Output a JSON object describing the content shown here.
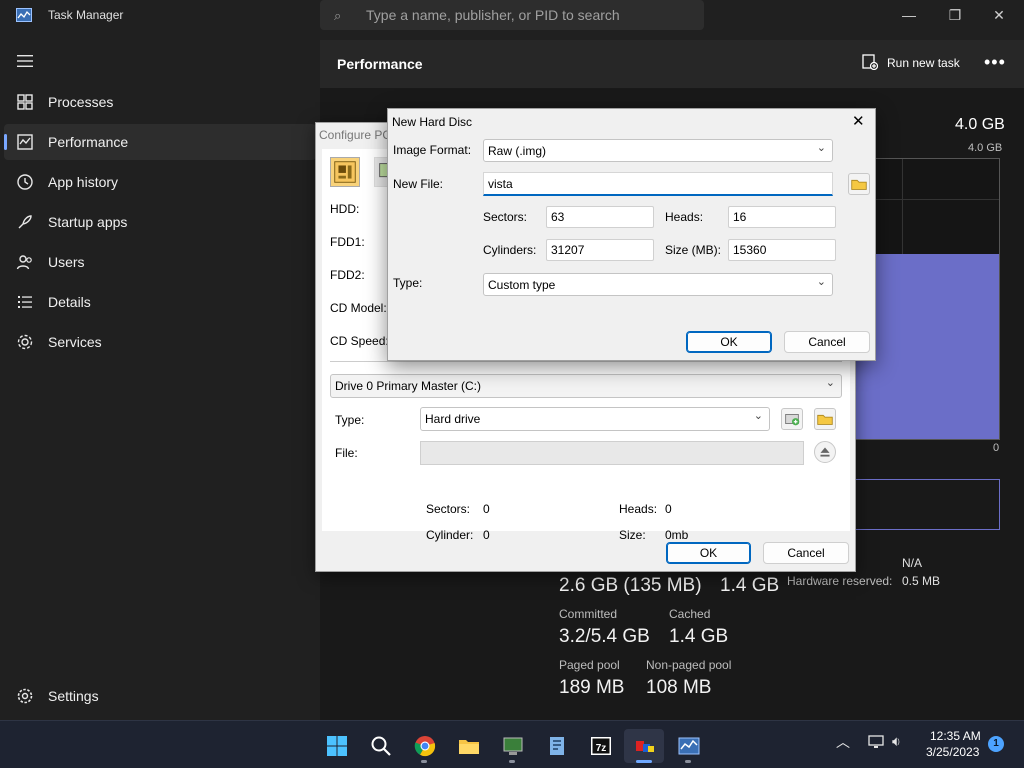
{
  "task_manager": {
    "title": "Task Manager",
    "search_placeholder": "Type a name, publisher, or PID to search",
    "nav": {
      "items": [
        {
          "label": "Processes",
          "icon": "processes-icon"
        },
        {
          "label": "Performance",
          "icon": "performance-icon",
          "active": true
        },
        {
          "label": "App history",
          "icon": "app-history-icon"
        },
        {
          "label": "Startup apps",
          "icon": "startup-apps-icon"
        },
        {
          "label": "Users",
          "icon": "users-icon"
        },
        {
          "label": "Details",
          "icon": "details-icon"
        },
        {
          "label": "Services",
          "icon": "services-icon"
        }
      ],
      "settings_label": "Settings"
    },
    "header": {
      "title": "Performance",
      "run_new_task": "Run new task"
    },
    "memory": {
      "total": "4.0 GB",
      "graph_max": "4.0 GB",
      "graph_min": "0",
      "in_use_value": "2.6 GB (135 MB)",
      "available_value": "1.4 GB",
      "committed_label": "Committed",
      "committed_value": "3.2/5.4 GB",
      "cached_label": "Cached",
      "cached_value": "1.4 GB",
      "paged_pool_label": "Paged pool",
      "paged_pool_value": "189 MB",
      "non_paged_pool_label": "Non-paged pool",
      "non_paged_pool_value": "108 MB",
      "na_value": "N/A",
      "hardware_reserved_label": "Hardware reserved:",
      "hardware_reserved_value": "0.5 MB",
      "graph_level": 0.66
    }
  },
  "configure_pc": {
    "title": "Configure PC",
    "labels": {
      "hdd": "HDD:",
      "fdd1": "FDD1:",
      "fdd2": "FDD2:",
      "cd_model": "CD Model:",
      "cd_speed": "CD Speed:"
    },
    "drive_select": "Drive 0 Primary Master (C:)",
    "type_label": "Type:",
    "type_value": "Hard drive",
    "file_label": "File:",
    "file_value": "",
    "sectors_label": "Sectors:",
    "sectors_value": "0",
    "heads_label": "Heads:",
    "heads_value": "0",
    "cylinder_label": "Cylinder:",
    "cylinder_value": "0",
    "size_label": "Size:",
    "size_value": "0mb",
    "ok": "OK",
    "cancel": "Cancel"
  },
  "new_hard_disc": {
    "title": "New Hard Disc",
    "image_format_label": "Image Format:",
    "image_format_value": "Raw (.img)",
    "new_file_label": "New File:",
    "new_file_value": "vista",
    "sectors_label": "Sectors:",
    "sectors_value": "63",
    "heads_label": "Heads:",
    "heads_value": "16",
    "cylinders_label": "Cylinders:",
    "cylinders_value": "31207",
    "size_label": "Size (MB):",
    "size_value": "15360",
    "type_label": "Type:",
    "type_value": "Custom type",
    "ok": "OK",
    "cancel": "Cancel"
  },
  "taskbar": {
    "apps": [
      "start-icon",
      "search-icon",
      "chrome-icon",
      "file-explorer-icon",
      "pcem-icon",
      "notepad-icon",
      "7zip-icon",
      "app-icon",
      "task-manager-icon"
    ],
    "time": "12:35 AM",
    "date": "3/25/2023",
    "notification_count": "1"
  }
}
